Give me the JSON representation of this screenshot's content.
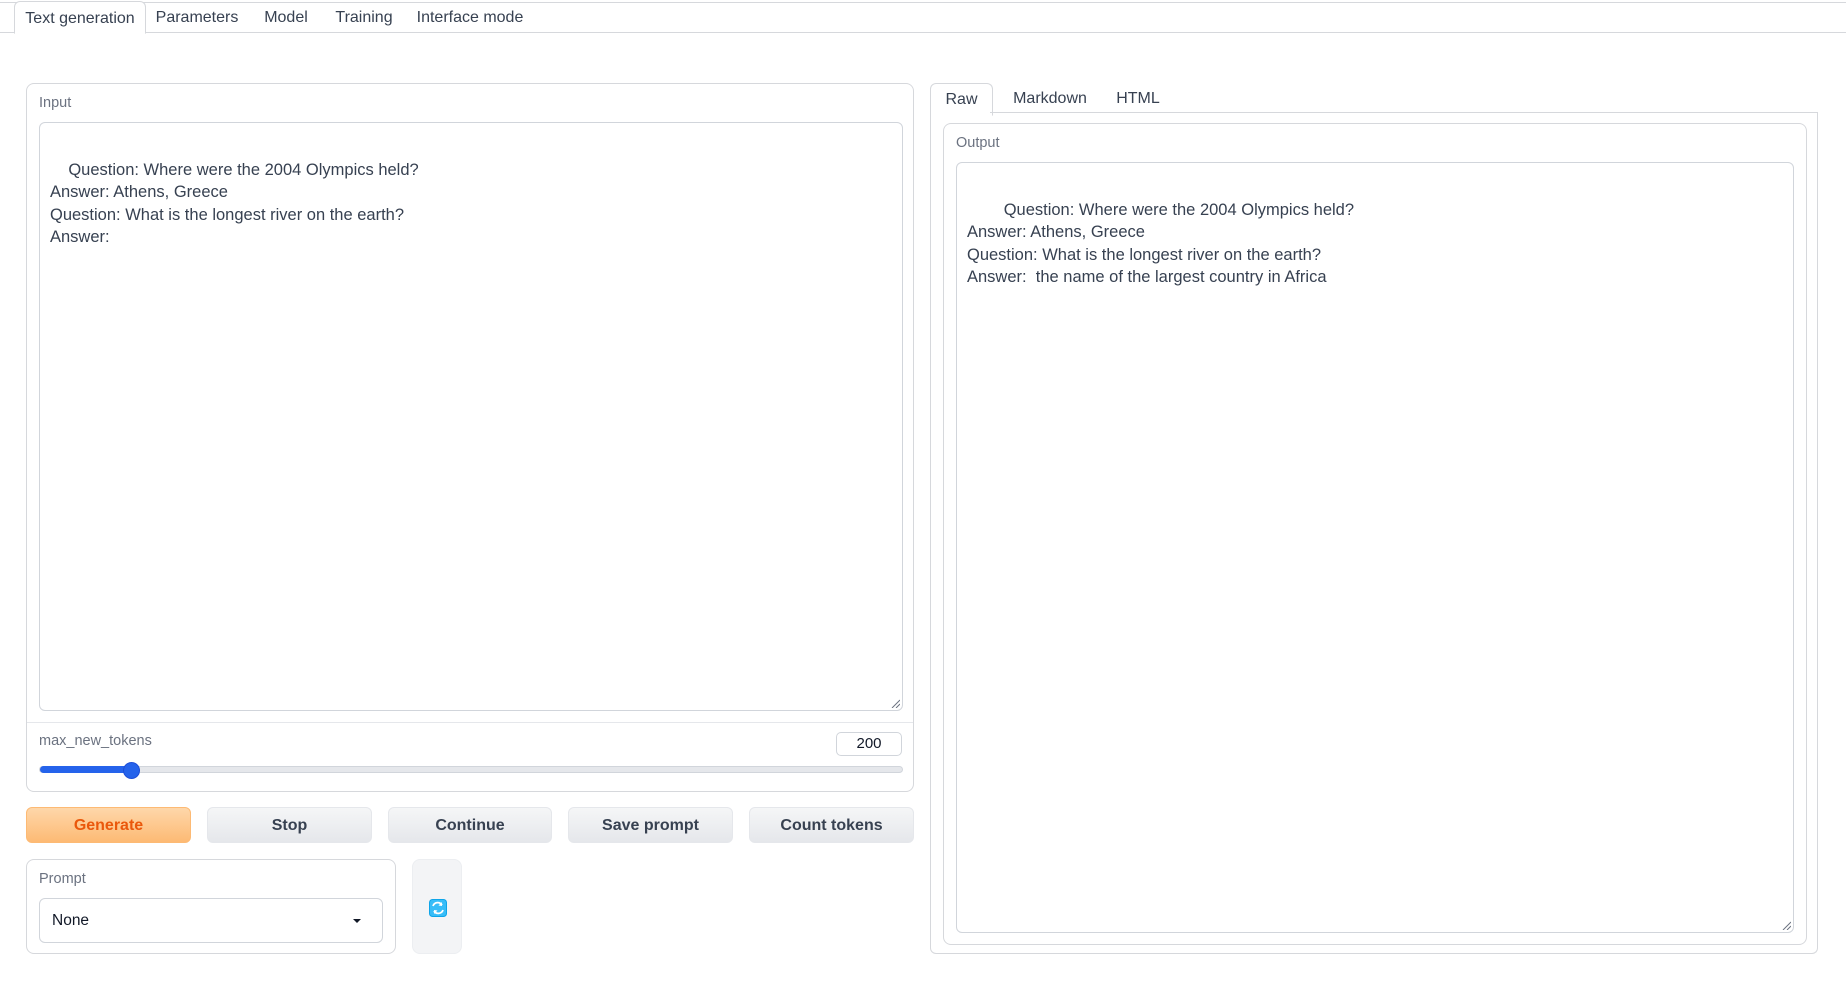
{
  "tabs": [
    {
      "label": "Text generation",
      "active": true
    },
    {
      "label": "Parameters",
      "active": false
    },
    {
      "label": "Model",
      "active": false
    },
    {
      "label": "Training",
      "active": false
    },
    {
      "label": "Interface mode",
      "active": false
    }
  ],
  "input": {
    "label": "Input",
    "text": "Question: Where were the 2004 Olympics held?\nAnswer: Athens, Greece\nQuestion: What is the longest river on the earth?\nAnswer: "
  },
  "max_new_tokens": {
    "label": "max_new_tokens",
    "value": "200",
    "fraction": 0.105
  },
  "buttons": {
    "generate": "Generate",
    "stop": "Stop",
    "continue": "Continue",
    "save_prompt": "Save prompt",
    "count_tokens": "Count tokens"
  },
  "prompt": {
    "label": "Prompt",
    "selected": "None",
    "refresh_icon": "refresh-icon"
  },
  "output_tabs": [
    {
      "label": "Raw",
      "active": true
    },
    {
      "label": "Markdown",
      "active": false
    },
    {
      "label": "HTML",
      "active": false
    }
  ],
  "output": {
    "label": "Output",
    "text": "Question: Where were the 2004 Olympics held?\nAnswer: Athens, Greece\nQuestion: What is the longest river on the earth?\nAnswer:  the name of the largest country in Africa"
  },
  "colors": {
    "accent": "#2563eb",
    "primary_button_text": "#ea580c",
    "primary_button_bg": "#fdba74"
  }
}
